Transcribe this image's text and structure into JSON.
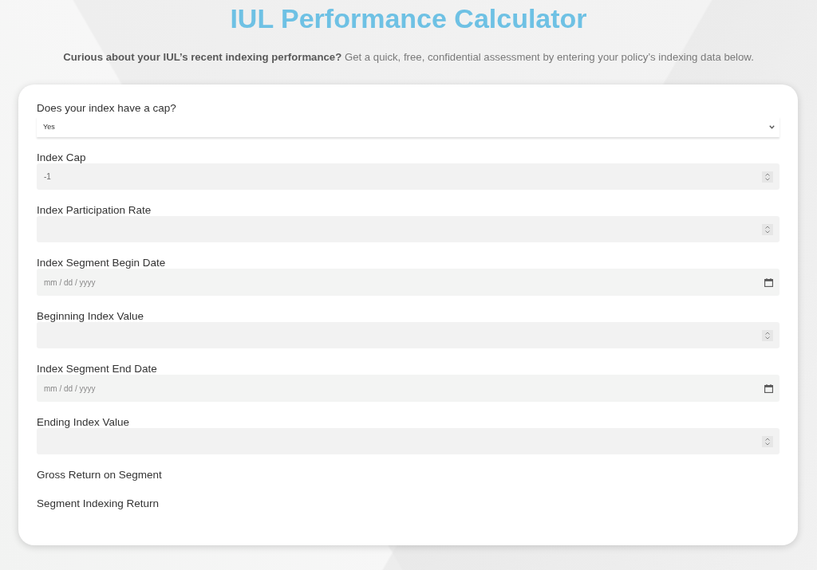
{
  "header": {
    "title": "IUL Performance Calculator",
    "intro": "**Curious about your IUL’s recent indexing performance?** Get a quick, free, confidential assessment by entering your policy’s indexing data below."
  },
  "form": {
    "fields": [
      {
        "kind": "select",
        "label": "Does your index have a cap?",
        "value": "Yes"
      },
      {
        "kind": "number",
        "label": "Index Cap",
        "value": "-1"
      },
      {
        "kind": "number",
        "label": "Index Participation Rate"
      },
      {
        "kind": "date",
        "label": "Index Segment Begin Date",
        "placeholder": "mm / dd / yyyy"
      },
      {
        "kind": "number",
        "label": "Beginning Index Value"
      },
      {
        "kind": "date",
        "label": "Index Segment End Date",
        "placeholder": "mm / dd / yyyy"
      },
      {
        "kind": "number",
        "label": "Ending Index Value"
      },
      {
        "kind": "output",
        "label": "Gross Return on Segment"
      },
      {
        "kind": "output",
        "label": "Segment Indexing Return"
      }
    ]
  }
}
